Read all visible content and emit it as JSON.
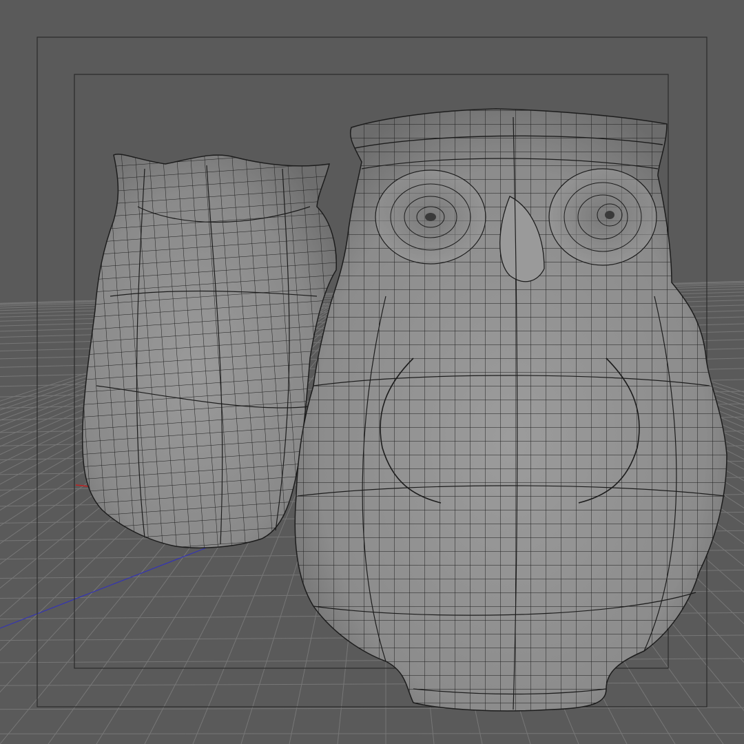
{
  "viewport": {
    "kind": "3d-perspective-viewport",
    "shading": "gouraud-shading-with-wireframe-lines",
    "colors": {
      "background": "#5a5a5a",
      "grid_line": "#777777",
      "safe_frame": "#2a2a2a",
      "mesh_fill": "#8c8c8c",
      "wire": "#1c1c1c",
      "axis_x": "#c02020",
      "axis_z": "#3030b0"
    },
    "objects": [
      {
        "name": "owl-back"
      },
      {
        "name": "owl-front"
      }
    ]
  }
}
